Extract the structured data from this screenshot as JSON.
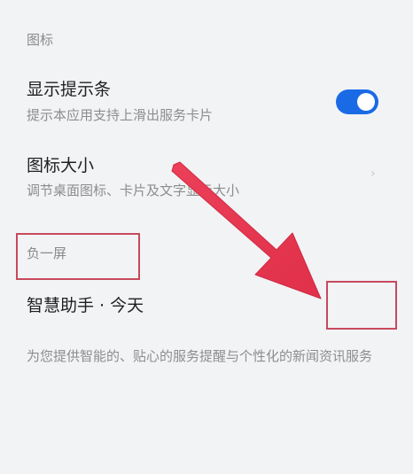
{
  "sections": {
    "icon_label": "图标",
    "minus_one_label": "负一屏"
  },
  "items": {
    "show_tip": {
      "title": "显示提示条",
      "desc": "提示本应用支持上滑出服务卡片",
      "toggle_on": true,
      "toggle_color": "#1a6ae6"
    },
    "icon_size": {
      "title": "图标大小",
      "desc": "调节桌面图标、卡片及文字显示大小",
      "chevron_icon": "chevron-right-icon"
    },
    "smart_assistant": {
      "title": "智慧助手 · 今天",
      "desc": "为您提供智能的、贴心的服务提醒与个性化的新闻资讯服务"
    }
  },
  "annotations": {
    "box_color": "#c7495c",
    "arrow_color": "#e8374f"
  }
}
